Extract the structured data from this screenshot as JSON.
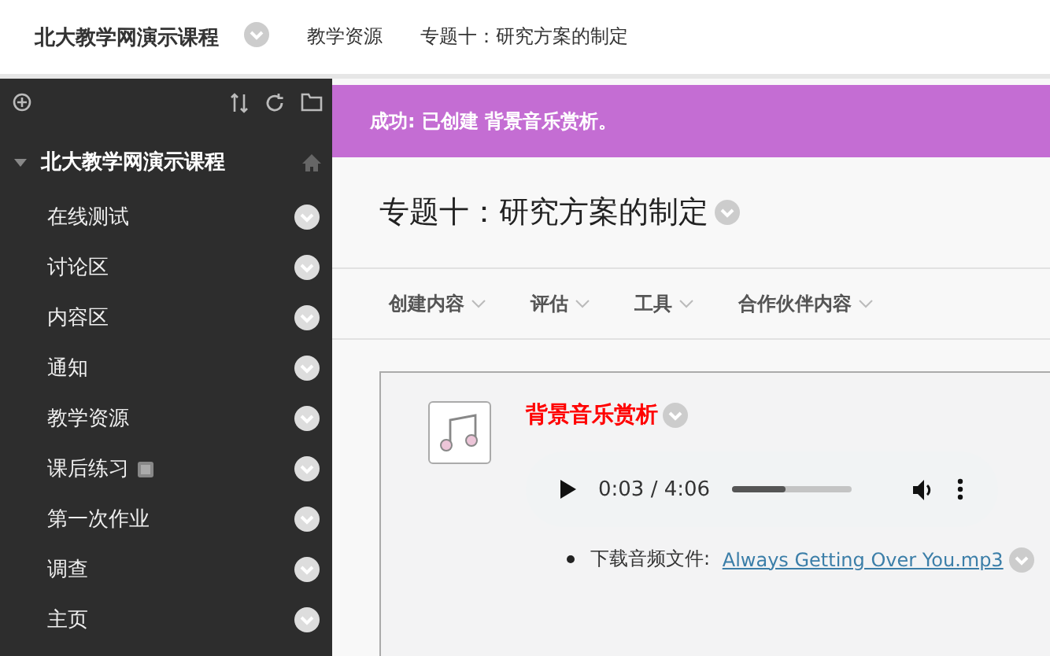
{
  "top_bar": {
    "course": "北大教学网演示课程",
    "breadcrumbs": [
      "教学资源",
      "专题十：研究方案的制定"
    ]
  },
  "sidebar": {
    "course": "北大教学网演示课程",
    "expanded": true,
    "items": [
      {
        "label": "在线测试",
        "hidden": false
      },
      {
        "label": "讨论区",
        "hidden": false
      },
      {
        "label": "内容区",
        "hidden": false
      },
      {
        "label": "通知",
        "hidden": false
      },
      {
        "label": "教学资源",
        "hidden": false
      },
      {
        "label": "课后练习",
        "hidden": true
      },
      {
        "label": "第一次作业",
        "hidden": false
      },
      {
        "label": "调查",
        "hidden": false
      },
      {
        "label": "主页",
        "hidden": false
      }
    ]
  },
  "banner": "成功: 已创建 背景音乐赏析。",
  "page_title": "专题十：研究方案的制定",
  "action_bar": [
    "创建内容",
    "评估",
    "工具",
    "合作伙伴内容"
  ],
  "item": {
    "title": "背景音乐赏析",
    "player": {
      "time": "0:03 / 4:06",
      "level": 0.45
    },
    "download_label": "下载音频文件: ",
    "download_link": "Always Getting Over You.mp3"
  }
}
